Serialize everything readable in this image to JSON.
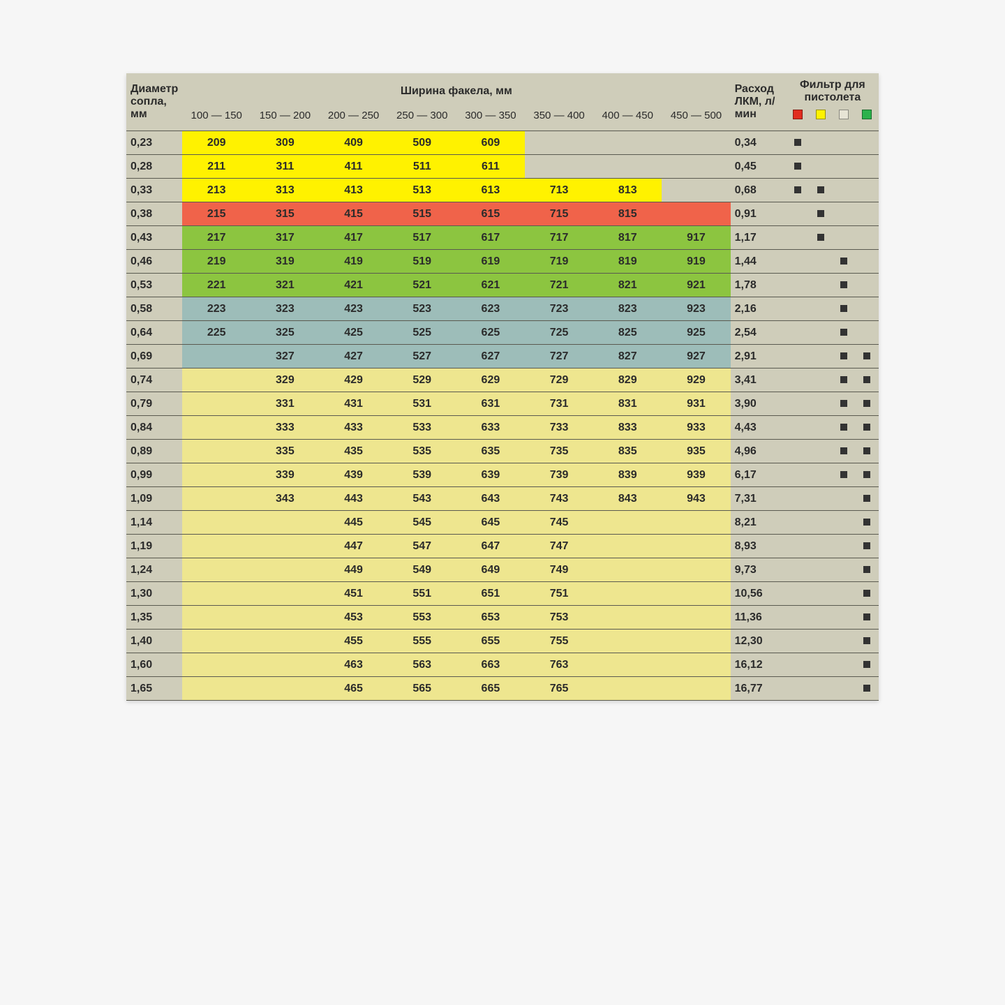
{
  "headers": {
    "dia": "Диаметр сопла, мм",
    "fan": "Ширина факела, мм",
    "flow": "Расход ЛКМ, л/мин",
    "filter": "Фильтр для пистолета",
    "ranges": [
      "100 — 150",
      "150 — 200",
      "200 — 250",
      "250 — 300",
      "300 — 350",
      "350 — 400",
      "400 — 450",
      "450 — 500"
    ]
  },
  "filter_colors": [
    "red",
    "yellow",
    "grey",
    "green"
  ],
  "rows": [
    {
      "dia": "0,23",
      "color": "yellow",
      "cells": [
        "209",
        "309",
        "409",
        "509",
        "609",
        "",
        "",
        ""
      ],
      "span": 5,
      "flow": "0,34",
      "filters": [
        true,
        false,
        false,
        false
      ]
    },
    {
      "dia": "0,28",
      "color": "yellow",
      "cells": [
        "211",
        "311",
        "411",
        "511",
        "611",
        "",
        "",
        ""
      ],
      "span": 5,
      "flow": "0,45",
      "filters": [
        true,
        false,
        false,
        false
      ]
    },
    {
      "dia": "0,33",
      "color": "yellow",
      "cells": [
        "213",
        "313",
        "413",
        "513",
        "613",
        "713",
        "813",
        ""
      ],
      "span": 7,
      "flow": "0,68",
      "filters": [
        true,
        true,
        false,
        false
      ]
    },
    {
      "dia": "0,38",
      "color": "orange",
      "cells": [
        "215",
        "315",
        "415",
        "515",
        "615",
        "715",
        "815",
        ""
      ],
      "span": 8,
      "flow": "0,91",
      "filters": [
        false,
        true,
        false,
        false
      ]
    },
    {
      "dia": "0,43",
      "color": "green",
      "cells": [
        "217",
        "317",
        "417",
        "517",
        "617",
        "717",
        "817",
        "917"
      ],
      "span": 8,
      "flow": "1,17",
      "filters": [
        false,
        true,
        false,
        false
      ]
    },
    {
      "dia": "0,46",
      "color": "green",
      "cells": [
        "219",
        "319",
        "419",
        "519",
        "619",
        "719",
        "819",
        "919"
      ],
      "span": 8,
      "flow": "1,44",
      "filters": [
        false,
        false,
        true,
        false
      ]
    },
    {
      "dia": "0,53",
      "color": "green",
      "cells": [
        "221",
        "321",
        "421",
        "521",
        "621",
        "721",
        "821",
        "921"
      ],
      "span": 8,
      "flow": "1,78",
      "filters": [
        false,
        false,
        true,
        false
      ]
    },
    {
      "dia": "0,58",
      "color": "steel",
      "cells": [
        "223",
        "323",
        "423",
        "523",
        "623",
        "723",
        "823",
        "923"
      ],
      "span": 8,
      "flow": "2,16",
      "filters": [
        false,
        false,
        true,
        false
      ]
    },
    {
      "dia": "0,64",
      "color": "steel",
      "cells": [
        "225",
        "325",
        "425",
        "525",
        "625",
        "725",
        "825",
        "925"
      ],
      "span": 8,
      "flow": "2,54",
      "filters": [
        false,
        false,
        true,
        false
      ]
    },
    {
      "dia": "0,69",
      "color": "steel",
      "cells": [
        "",
        "327",
        "427",
        "527",
        "627",
        "727",
        "827",
        "927"
      ],
      "span": 8,
      "flow": "2,91",
      "filters": [
        false,
        false,
        true,
        true
      ]
    },
    {
      "dia": "0,74",
      "color": "pale",
      "cells": [
        "",
        "329",
        "429",
        "529",
        "629",
        "729",
        "829",
        "929"
      ],
      "span": 8,
      "flow": "3,41",
      "filters": [
        false,
        false,
        true,
        true
      ]
    },
    {
      "dia": "0,79",
      "color": "pale",
      "cells": [
        "",
        "331",
        "431",
        "531",
        "631",
        "731",
        "831",
        "931"
      ],
      "span": 8,
      "flow": "3,90",
      "filters": [
        false,
        false,
        true,
        true
      ]
    },
    {
      "dia": "0,84",
      "color": "pale",
      "cells": [
        "",
        "333",
        "433",
        "533",
        "633",
        "733",
        "833",
        "933"
      ],
      "span": 8,
      "flow": "4,43",
      "filters": [
        false,
        false,
        true,
        true
      ]
    },
    {
      "dia": "0,89",
      "color": "pale",
      "cells": [
        "",
        "335",
        "435",
        "535",
        "635",
        "735",
        "835",
        "935"
      ],
      "span": 8,
      "flow": "4,96",
      "filters": [
        false,
        false,
        true,
        true
      ]
    },
    {
      "dia": "0,99",
      "color": "pale",
      "cells": [
        "",
        "339",
        "439",
        "539",
        "639",
        "739",
        "839",
        "939"
      ],
      "span": 8,
      "flow": "6,17",
      "filters": [
        false,
        false,
        true,
        true
      ]
    },
    {
      "dia": "1,09",
      "color": "pale",
      "cells": [
        "",
        "343",
        "443",
        "543",
        "643",
        "743",
        "843",
        "943"
      ],
      "span": 8,
      "flow": "7,31",
      "filters": [
        false,
        false,
        false,
        true
      ]
    },
    {
      "dia": "1,14",
      "color": "pale",
      "cells": [
        "",
        "",
        "445",
        "545",
        "645",
        "745",
        "",
        ""
      ],
      "span": 8,
      "flow": "8,21",
      "filters": [
        false,
        false,
        false,
        true
      ]
    },
    {
      "dia": "1,19",
      "color": "pale",
      "cells": [
        "",
        "",
        "447",
        "547",
        "647",
        "747",
        "",
        ""
      ],
      "span": 8,
      "flow": "8,93",
      "filters": [
        false,
        false,
        false,
        true
      ]
    },
    {
      "dia": "1,24",
      "color": "pale",
      "cells": [
        "",
        "",
        "449",
        "549",
        "649",
        "749",
        "",
        ""
      ],
      "span": 8,
      "flow": "9,73",
      "filters": [
        false,
        false,
        false,
        true
      ]
    },
    {
      "dia": "1,30",
      "color": "pale",
      "cells": [
        "",
        "",
        "451",
        "551",
        "651",
        "751",
        "",
        ""
      ],
      "span": 8,
      "flow": "10,56",
      "filters": [
        false,
        false,
        false,
        true
      ]
    },
    {
      "dia": "1,35",
      "color": "pale",
      "cells": [
        "",
        "",
        "453",
        "553",
        "653",
        "753",
        "",
        ""
      ],
      "span": 8,
      "flow": "11,36",
      "filters": [
        false,
        false,
        false,
        true
      ]
    },
    {
      "dia": "1,40",
      "color": "pale",
      "cells": [
        "",
        "",
        "455",
        "555",
        "655",
        "755",
        "",
        ""
      ],
      "span": 8,
      "flow": "12,30",
      "filters": [
        false,
        false,
        false,
        true
      ]
    },
    {
      "dia": "1,60",
      "color": "pale",
      "cells": [
        "",
        "",
        "463",
        "563",
        "663",
        "763",
        "",
        ""
      ],
      "span": 8,
      "flow": "16,12",
      "filters": [
        false,
        false,
        false,
        true
      ]
    },
    {
      "dia": "1,65",
      "color": "pale",
      "cells": [
        "",
        "",
        "465",
        "565",
        "665",
        "765",
        "",
        ""
      ],
      "span": 8,
      "flow": "16,77",
      "filters": [
        false,
        false,
        false,
        true
      ]
    }
  ]
}
